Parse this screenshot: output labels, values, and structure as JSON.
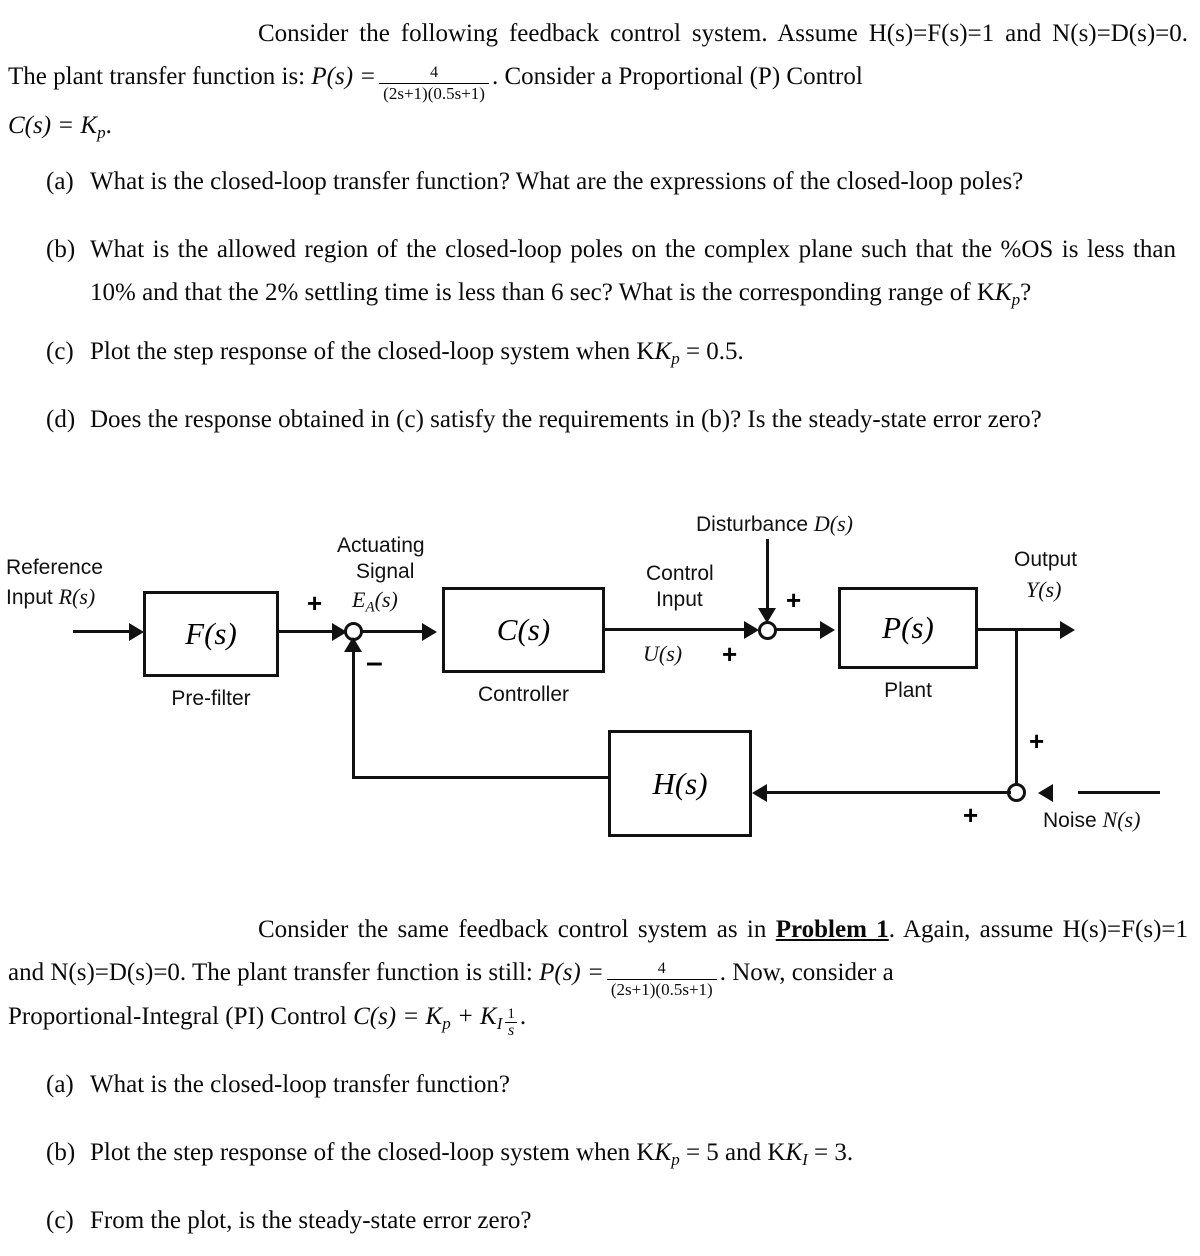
{
  "problem1": {
    "intro": {
      "lead": "Consider the following feedback control system. Assume H(s)=F(s)=1 and N(s)=D(s)=0. The plant transfer function is:",
      "plant_lhs": "P(s) =",
      "plant_numerator": "4",
      "plant_denominator": "(2s+1)(0.5s+1)",
      "after_fraction": ". Consider a Proportional (P) Control",
      "controller_line": "C(s) = K",
      "controller_sub": "p",
      "controller_period": "."
    },
    "items": [
      {
        "label": "(a)",
        "text": "What is the closed-loop transfer function? What are the expressions of the closed-loop poles?"
      },
      {
        "label": "(b)",
        "text": "What is the allowed region of the closed-loop poles on the complex plane such that the %OS is less than 10% and that the 2% settling time is less than 6 sec? What is the corresponding range of K",
        "text_sub": "p",
        "text_tail": "?"
      },
      {
        "label": "(c)",
        "text": "Plot the step response of the closed-loop system when K",
        "text_sub": "p",
        "text_tail": " = 0.5."
      },
      {
        "label": "(d)",
        "text": "Does the response obtained in (c) satisfy the requirements in (b)? Is the steady-state error zero?"
      }
    ]
  },
  "diagram": {
    "labels": {
      "reference_line1": "Reference",
      "reference_line2": "Input",
      "reference_symbol": "R(s)",
      "actuating_line1": "Actuating",
      "actuating_line2": "Signal",
      "actuating_symbol": "E",
      "actuating_symbol_sub": "A",
      "actuating_symbol_tail": "(s)",
      "control_line1": "Control",
      "control_line2": "Input",
      "control_symbol": "U(s)",
      "disturbance": "Disturbance",
      "disturbance_symbol": "D(s)",
      "output": "Output",
      "output_symbol": "Y(s)",
      "noise": "Noise",
      "noise_symbol": "N(s)"
    },
    "blocks": [
      {
        "name": "prefilter",
        "expr": "F(s)",
        "caption": "Pre-filter"
      },
      {
        "name": "controller",
        "expr": "C(s)",
        "caption": "Controller"
      },
      {
        "name": "plant",
        "expr": "P(s)",
        "caption": "Plant"
      },
      {
        "name": "feedback",
        "expr": "H(s)",
        "caption": ""
      }
    ],
    "signs": {
      "sum1_plus": "+",
      "sum1_minus": "–",
      "sum2_plus_top": "+",
      "sum2_plus_bottom": "+",
      "sum3_plus_top": "+",
      "sum3_plus_bottom": "+"
    }
  },
  "problem2": {
    "intro": {
      "lead": "Consider the same feedback control system as in",
      "ref": "Problem 1",
      "lead2": ". Again, assume H(s)=F(s)=1 and N(s)=D(s)=0. The plant transfer function is still:",
      "plant_lhs": "P(s) =",
      "plant_numerator": "4",
      "plant_denominator": "(2s+1)(0.5s+1)",
      "after_fraction": ". Now, consider a",
      "controller_line_pre": "Proportional-Integral (PI) Control",
      "controller_expr_a": "C(s) = K",
      "controller_sub_a": "p",
      "controller_plus": " + K",
      "controller_sub_b": "I",
      "controller_frac_num": "1",
      "controller_frac_den": "s",
      "controller_period": "."
    },
    "items": [
      {
        "label": "(a)",
        "text": "What is the closed-loop transfer function?"
      },
      {
        "label": "(b)",
        "text": "Plot the step response of the closed-loop system when K",
        "text_sub": "p",
        "text_mid": " = 5 and K",
        "text_sub2": "I",
        "text_tail": " = 3."
      },
      {
        "label": "(c)",
        "text": "From the plot, is the steady-state error zero?"
      }
    ]
  },
  "colors": {
    "ink": "#0a0a0a",
    "line": "#111111",
    "background": "#ffffff"
  }
}
